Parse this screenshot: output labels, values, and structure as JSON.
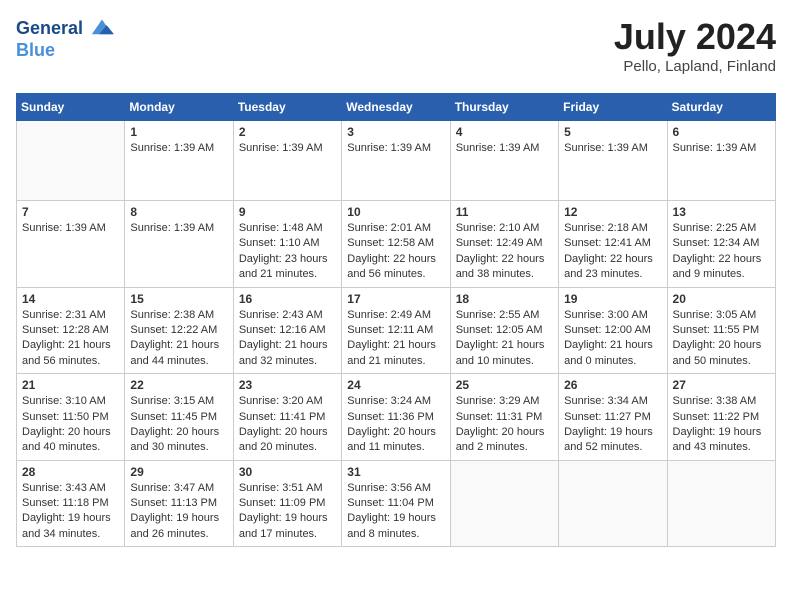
{
  "logo": {
    "line1": "General",
    "line2": "Blue"
  },
  "title": {
    "month_year": "July 2024",
    "location": "Pello, Lapland, Finland"
  },
  "weekdays": [
    "Sunday",
    "Monday",
    "Tuesday",
    "Wednesday",
    "Thursday",
    "Friday",
    "Saturday"
  ],
  "weeks": [
    [
      {
        "day": "",
        "content": ""
      },
      {
        "day": "1",
        "content": "Sunrise: 1:39 AM"
      },
      {
        "day": "2",
        "content": "Sunrise: 1:39 AM"
      },
      {
        "day": "3",
        "content": "Sunrise: 1:39 AM"
      },
      {
        "day": "4",
        "content": "Sunrise: 1:39 AM"
      },
      {
        "day": "5",
        "content": "Sunrise: 1:39 AM"
      },
      {
        "day": "6",
        "content": "Sunrise: 1:39 AM"
      }
    ],
    [
      {
        "day": "7",
        "content": "Sunrise: 1:39 AM"
      },
      {
        "day": "8",
        "content": "Sunrise: 1:39 AM"
      },
      {
        "day": "9",
        "content": "Sunrise: 1:48 AM\nSunset: 1:10 AM\nDaylight: 23 hours and 21 minutes."
      },
      {
        "day": "10",
        "content": "Sunrise: 2:01 AM\nSunset: 12:58 AM\nDaylight: 22 hours and 56 minutes."
      },
      {
        "day": "11",
        "content": "Sunrise: 2:10 AM\nSunset: 12:49 AM\nDaylight: 22 hours and 38 minutes."
      },
      {
        "day": "12",
        "content": "Sunrise: 2:18 AM\nSunset: 12:41 AM\nDaylight: 22 hours and 23 minutes."
      },
      {
        "day": "13",
        "content": "Sunrise: 2:25 AM\nSunset: 12:34 AM\nDaylight: 22 hours and 9 minutes."
      }
    ],
    [
      {
        "day": "14",
        "content": "Sunrise: 2:31 AM\nSunset: 12:28 AM\nDaylight: 21 hours and 56 minutes."
      },
      {
        "day": "15",
        "content": "Sunrise: 2:38 AM\nSunset: 12:22 AM\nDaylight: 21 hours and 44 minutes."
      },
      {
        "day": "16",
        "content": "Sunrise: 2:43 AM\nSunset: 12:16 AM\nDaylight: 21 hours and 32 minutes."
      },
      {
        "day": "17",
        "content": "Sunrise: 2:49 AM\nSunset: 12:11 AM\nDaylight: 21 hours and 21 minutes."
      },
      {
        "day": "18",
        "content": "Sunrise: 2:55 AM\nSunset: 12:05 AM\nDaylight: 21 hours and 10 minutes."
      },
      {
        "day": "19",
        "content": "Sunrise: 3:00 AM\nSunset: 12:00 AM\nDaylight: 21 hours and 0 minutes."
      },
      {
        "day": "20",
        "content": "Sunrise: 3:05 AM\nSunset: 11:55 PM\nDaylight: 20 hours and 50 minutes."
      }
    ],
    [
      {
        "day": "21",
        "content": "Sunrise: 3:10 AM\nSunset: 11:50 PM\nDaylight: 20 hours and 40 minutes."
      },
      {
        "day": "22",
        "content": "Sunrise: 3:15 AM\nSunset: 11:45 PM\nDaylight: 20 hours and 30 minutes."
      },
      {
        "day": "23",
        "content": "Sunrise: 3:20 AM\nSunset: 11:41 PM\nDaylight: 20 hours and 20 minutes."
      },
      {
        "day": "24",
        "content": "Sunrise: 3:24 AM\nSunset: 11:36 PM\nDaylight: 20 hours and 11 minutes."
      },
      {
        "day": "25",
        "content": "Sunrise: 3:29 AM\nSunset: 11:31 PM\nDaylight: 20 hours and 2 minutes."
      },
      {
        "day": "26",
        "content": "Sunrise: 3:34 AM\nSunset: 11:27 PM\nDaylight: 19 hours and 52 minutes."
      },
      {
        "day": "27",
        "content": "Sunrise: 3:38 AM\nSunset: 11:22 PM\nDaylight: 19 hours and 43 minutes."
      }
    ],
    [
      {
        "day": "28",
        "content": "Sunrise: 3:43 AM\nSunset: 11:18 PM\nDaylight: 19 hours and 34 minutes."
      },
      {
        "day": "29",
        "content": "Sunrise: 3:47 AM\nSunset: 11:13 PM\nDaylight: 19 hours and 26 minutes."
      },
      {
        "day": "30",
        "content": "Sunrise: 3:51 AM\nSunset: 11:09 PM\nDaylight: 19 hours and 17 minutes."
      },
      {
        "day": "31",
        "content": "Sunrise: 3:56 AM\nSunset: 11:04 PM\nDaylight: 19 hours and 8 minutes."
      },
      {
        "day": "",
        "content": ""
      },
      {
        "day": "",
        "content": ""
      },
      {
        "day": "",
        "content": ""
      }
    ]
  ]
}
